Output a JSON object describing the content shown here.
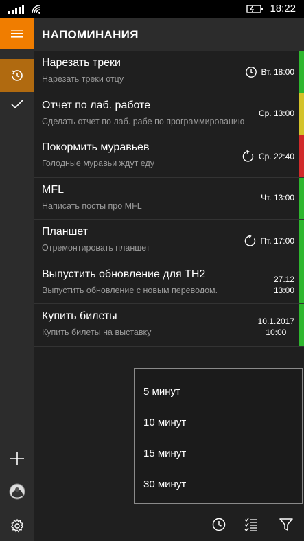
{
  "status": {
    "time": "18:22"
  },
  "header": {
    "title": "НАПОМИНАНИЯ"
  },
  "colors": {
    "accent": "#f07d00",
    "history_bg": "#b06a10",
    "green": "#2fb82f",
    "yellow": "#d4c32a",
    "red": "#d22a2a"
  },
  "reminders": [
    {
      "title": "Нарезать треки",
      "subtitle": "Нарезать треки отцу",
      "time": "Вт. 18:00",
      "icon": "clock-icon",
      "priority": "#2fb82f"
    },
    {
      "title": "Отчет по лаб. работе",
      "subtitle": "Сделать отчет по лаб. рабе по программированию",
      "time": "Ср. 13:00",
      "icon": "",
      "priority": "#d4c32a"
    },
    {
      "title": "Покормить муравьев",
      "subtitle": "Голодные муравьи ждут еду",
      "time": "Ср. 22:40",
      "icon": "repeat-icon",
      "priority": "#d22a2a"
    },
    {
      "title": "MFL",
      "subtitle": "Написать посты про MFL",
      "time": "Чт. 13:00",
      "icon": "",
      "priority": "#2fb82f"
    },
    {
      "title": "Планшет",
      "subtitle": "Отремонтировать планшет",
      "time": "Пт. 17:00",
      "icon": "repeat-icon",
      "priority": "#2fb82f"
    },
    {
      "title": "Выпустить обновление для TH2",
      "subtitle": "Выпустить обновление с новым переводом.",
      "date": "27.12",
      "time": "13:00",
      "icon": "",
      "priority": "#2fb82f"
    },
    {
      "title": "Купить билеты",
      "subtitle": "Купить билеты на выставку",
      "date": "10.1.2017",
      "time": "10:00",
      "icon": "",
      "priority": "#2fb82f"
    }
  ],
  "snooze_menu": [
    "5 минут",
    "10 минут",
    "15 минут",
    "30 минут"
  ]
}
